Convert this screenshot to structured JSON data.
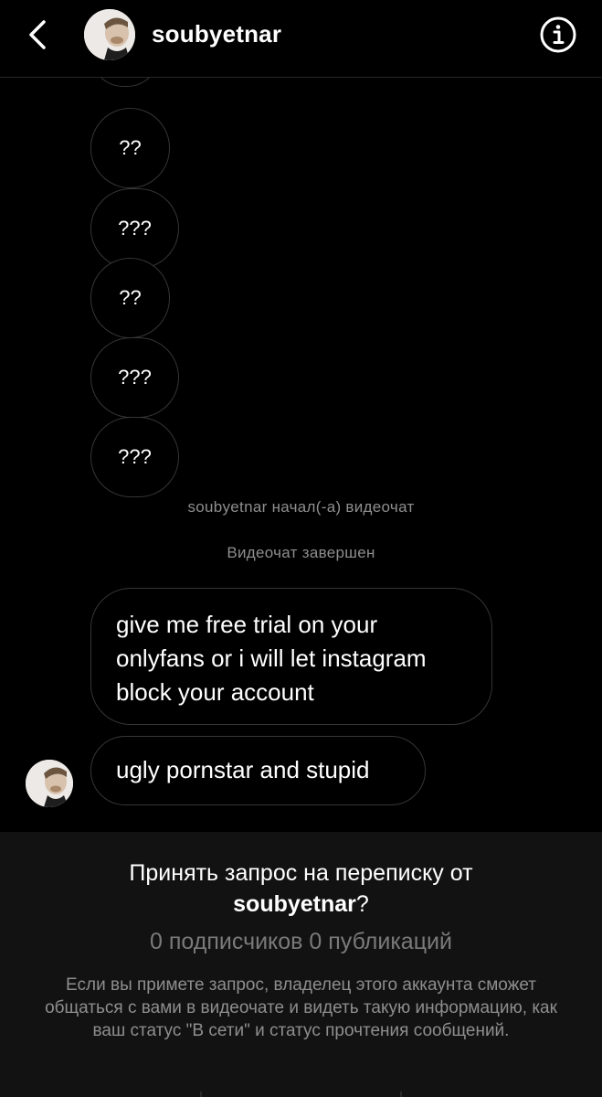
{
  "header": {
    "username": "soubyetnar"
  },
  "messages": {
    "small": [
      "??",
      "???",
      "??",
      "???",
      "???"
    ],
    "video_started": "soubyetnar начал(-а) видеочат",
    "video_ended": "Видеочат завершен",
    "long_lines": [
      "give me free trial on your",
      "onlyfans or i will let instagram",
      "block your account"
    ],
    "last": "ugly pornstar and stupid"
  },
  "request": {
    "title_prefix": "Принять запрос на переписку от",
    "title_user": "soubyetnar",
    "title_suffix": "?",
    "stats": "0 подписчиков 0 публикаций",
    "description": "Если вы примете запрос, владелец этого аккаунта сможет общаться с вами в видеочате и видеть такую информацию, как ваш статус \"В сети\" и статус прочтения сообщений."
  },
  "colors": {
    "background": "#000000",
    "bubble_border": "#363636",
    "muted_text": "#8e8e8e",
    "panel_bg": "#121212"
  },
  "icons": {
    "back": "chevron-left-icon",
    "info": "info-icon"
  }
}
